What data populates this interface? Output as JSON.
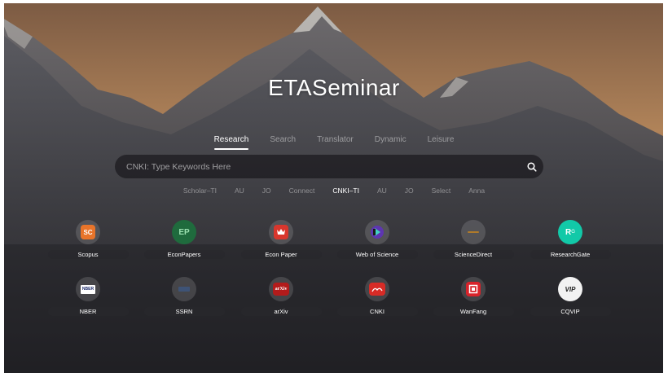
{
  "app": {
    "title": "ETASeminar"
  },
  "tabs": [
    {
      "label": "Research",
      "active": true
    },
    {
      "label": "Search",
      "active": false
    },
    {
      "label": "Translator",
      "active": false
    },
    {
      "label": "Dynamic",
      "active": false
    },
    {
      "label": "Leisure",
      "active": false
    }
  ],
  "search": {
    "placeholder": "CNKI: Type Keywords Here",
    "value": "",
    "icon": "search-icon"
  },
  "engines": [
    {
      "label": "Scholar–TI",
      "active": false
    },
    {
      "label": "AU",
      "active": false
    },
    {
      "label": "JO",
      "active": false
    },
    {
      "label": "Connect",
      "active": false
    },
    {
      "label": "CNKI–TI",
      "active": true
    },
    {
      "label": "AU",
      "active": false
    },
    {
      "label": "JO",
      "active": false
    },
    {
      "label": "Select",
      "active": false
    },
    {
      "label": "Anna",
      "active": false
    }
  ],
  "sites": [
    {
      "label": "Scopus",
      "icon": "scopus-icon",
      "logo_text": "SC",
      "color": "#e8742a"
    },
    {
      "label": "EconPapers",
      "icon": "econpapers-icon",
      "logo_text": "EP",
      "color": "#1f6b3d"
    },
    {
      "label": "Econ Paper",
      "icon": "econ-paper-icon",
      "logo_text": "",
      "color": "#d8362d"
    },
    {
      "label": "Web of Science",
      "icon": "web-of-science-icon",
      "logo_text": "",
      "color": "#5e35b1"
    },
    {
      "label": "ScienceDirect",
      "icon": "sciencedirect-icon",
      "logo_text": "",
      "color": "#b07a2a"
    },
    {
      "label": "ResearchGate",
      "icon": "researchgate-icon",
      "logo_text": "R",
      "color": "#12c9a8"
    },
    {
      "label": "NBER",
      "icon": "nber-icon",
      "logo_text": "NBER",
      "color": "#ffffff"
    },
    {
      "label": "SSRN",
      "icon": "ssrn-icon",
      "logo_text": "",
      "color": "#3c5a8a"
    },
    {
      "label": "arXiv",
      "icon": "arxiv-icon",
      "logo_text": "arXiv",
      "color": "#b31b1b"
    },
    {
      "label": "CNKI",
      "icon": "cnki-icon",
      "logo_text": "",
      "color": "#d72b26"
    },
    {
      "label": "WanFang",
      "icon": "wanfang-icon",
      "logo_text": "",
      "color": "#d8232a"
    },
    {
      "label": "CQVIP",
      "icon": "cqvip-icon",
      "logo_text": "VIP",
      "color": "#222222"
    }
  ]
}
